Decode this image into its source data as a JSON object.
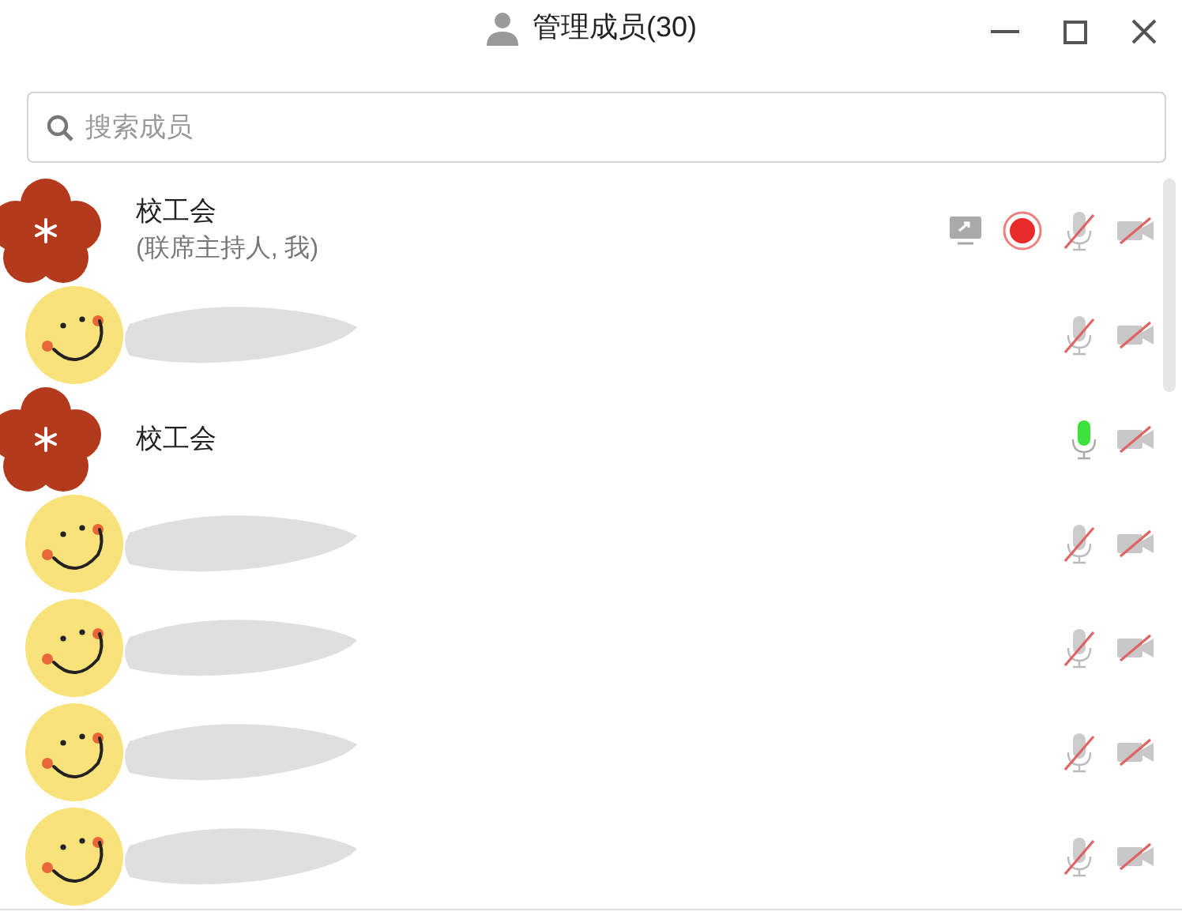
{
  "window": {
    "title": "管理成员(30)"
  },
  "search": {
    "placeholder": "搜索成员"
  },
  "members": [
    {
      "kind": "flower",
      "name": "校工会",
      "note": "(联席主持人, 我)",
      "redacted": false,
      "sharing": true,
      "recording": true,
      "mic_on": false,
      "camera_on": false
    },
    {
      "kind": "smiley",
      "redacted": true,
      "sharing": false,
      "recording": false,
      "mic_on": false,
      "camera_on": false
    },
    {
      "kind": "flower",
      "name": "校工会",
      "redacted": false,
      "sharing": false,
      "recording": false,
      "mic_on": true,
      "camera_on": false
    },
    {
      "kind": "smiley",
      "redacted": true,
      "sharing": false,
      "recording": false,
      "mic_on": false,
      "camera_on": false
    },
    {
      "kind": "smiley",
      "redacted": true,
      "sharing": false,
      "recording": false,
      "mic_on": false,
      "camera_on": false
    },
    {
      "kind": "smiley",
      "redacted": true,
      "sharing": false,
      "recording": false,
      "mic_on": false,
      "camera_on": false
    },
    {
      "kind": "smiley",
      "redacted": true,
      "sharing": false,
      "recording": false,
      "mic_on": false,
      "camera_on": false
    }
  ]
}
